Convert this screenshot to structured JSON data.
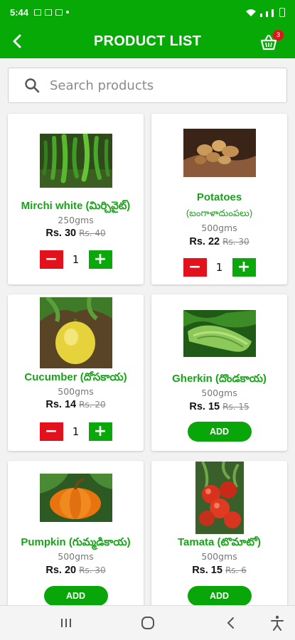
{
  "status": {
    "time": "5:44"
  },
  "header": {
    "title": "PRODUCT LIST",
    "cart_count": "3"
  },
  "search": {
    "placeholder": "Search products"
  },
  "products": [
    {
      "name": "Mirchi white (మిర్చివైట్)",
      "name_lines": [
        "Mirchi white (మిర్చివైట్)"
      ],
      "weight": "250gms",
      "price": "Rs. 30",
      "old_price": "Rs. 40",
      "qty": "1",
      "state": "qty",
      "image": "green-chillies"
    },
    {
      "name_lines": [
        "Potatoes",
        "(బంగాళాదుంపలు)"
      ],
      "weight": "500gms",
      "price": "Rs. 22",
      "old_price": "Rs. 30",
      "qty": "1",
      "state": "qty",
      "image": "potatoes"
    },
    {
      "name_lines": [
        "Cucumber (దోసకాయ)"
      ],
      "weight": "500gms",
      "price": "Rs. 14",
      "old_price": "Rs. 20",
      "qty": "1",
      "state": "qty",
      "image": "yellow-cucumber"
    },
    {
      "name_lines": [
        "Gherkin (దొండకాయ)"
      ],
      "weight": "500gms",
      "price": "Rs. 15",
      "old_price": "Rs. 15",
      "state": "add",
      "add_label": "ADD",
      "image": "gherkin"
    },
    {
      "name_lines": [
        "Pumpkin (గుమ్మడికాయ)"
      ],
      "weight": "500gms",
      "price": "Rs. 20",
      "old_price": "Rs. 30",
      "state": "add",
      "add_label": "ADD",
      "image": "pumpkin"
    },
    {
      "name_lines": [
        "Tamata (టొమాటో)"
      ],
      "weight": "500gms",
      "price": "Rs. 15",
      "old_price": "Rs. 6",
      "state": "add",
      "add_label": "ADD",
      "image": "tomatoes"
    }
  ],
  "colors": {
    "primary": "#07a907",
    "minus": "#e3111c",
    "plus": "#0aa80a",
    "badge": "#e0141a",
    "product_name": "#19a319"
  }
}
